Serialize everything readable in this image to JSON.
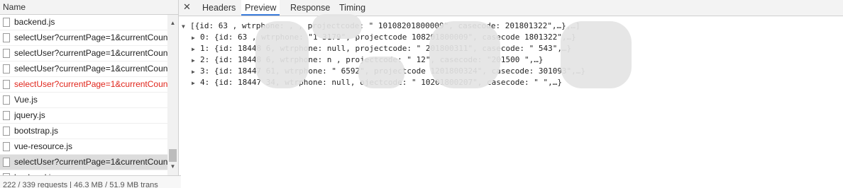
{
  "left_panel": {
    "header": "Name",
    "items": [
      {
        "label": "backend.js",
        "state": "normal"
      },
      {
        "label": "selectUser?currentPage=1&currentCoun",
        "state": "normal"
      },
      {
        "label": "selectUser?currentPage=1&currentCoun",
        "state": "normal"
      },
      {
        "label": "selectUser?currentPage=1&currentCoun",
        "state": "normal"
      },
      {
        "label": "selectUser?currentPage=1&currentCoun",
        "state": "error"
      },
      {
        "label": "Vue.js",
        "state": "normal"
      },
      {
        "label": "jquery.js",
        "state": "normal"
      },
      {
        "label": "bootstrap.js",
        "state": "normal"
      },
      {
        "label": "vue-resource.js",
        "state": "normal"
      },
      {
        "label": "selectUser?currentPage=1&currentCoun",
        "state": "selected"
      },
      {
        "label": "backend.js",
        "state": "normal"
      }
    ],
    "status": "222 / 339 requests | 46.3 MB / 51.9 MB trans"
  },
  "tabs": [
    {
      "label": "Headers",
      "active": false
    },
    {
      "label": "Preview",
      "active": true
    },
    {
      "label": "Response",
      "active": false
    },
    {
      "label": "Timing",
      "active": false
    }
  ],
  "preview": {
    "lines": [
      "[{id: 63     , wtrphone:         ,  , projectcode: \"   10108201800009\", casecode:      201801322\",…},…]",
      "0: {id: 63     , wtrphone: \"1     3179\", projectcode     108201800009\", casecode        1801322\",…}",
      "1: {id: 18448   6, wtrphone: null, projectcode: \"        201800311\", casecode: \"       543\",…}",
      "2: {id: 18448   6, wtrphone: n     , projectcode: \"         12\", casecode: \"201500   \",…}",
      "3: {id: 18447   61, wtrphone: \"     6592\", projectcode       1201800324\", casecode:       301093\",…}",
      "4: {id: 18447  34, wtrphone: null,      ojectcode: \"      10201800207\", casecode: \"     \",…}"
    ]
  },
  "colors": {
    "error_text": "#e0251b",
    "active_tab_underline": "#3b7ddd",
    "selected_row": "#dcdcdc"
  }
}
